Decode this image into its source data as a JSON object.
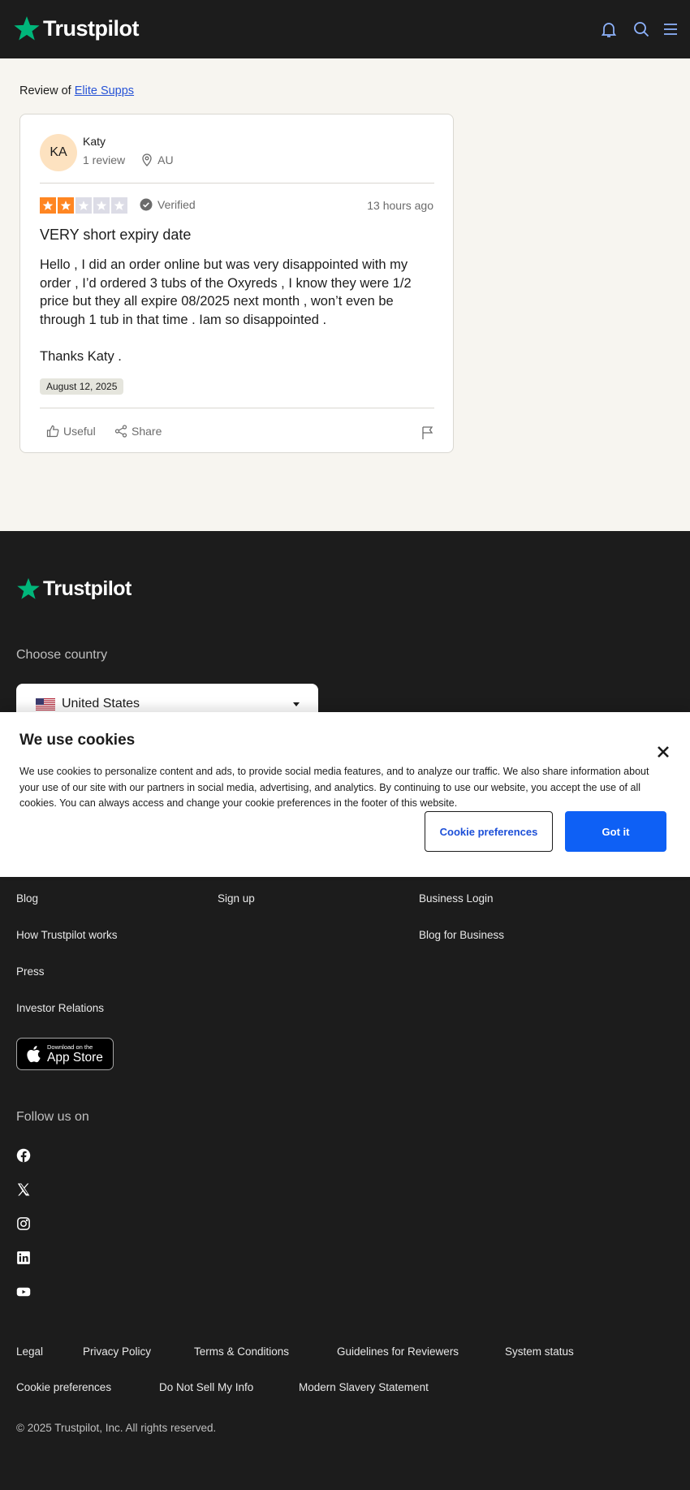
{
  "header": {
    "logo_text": "Trustpilot",
    "icons": [
      "bell-icon",
      "search-icon",
      "menu-icon"
    ],
    "accent_color": "#00b67a",
    "icon_color": "#8fb4ff"
  },
  "breadcrumb": {
    "prefix": "Review of",
    "company": "Elite Supps"
  },
  "review": {
    "initials": "KA",
    "name": "Katy",
    "review_count": "1 review",
    "country": "AU",
    "rating": 2,
    "max_rating": 5,
    "star_color": "#ff8622",
    "verified_label": "Verified",
    "time_ago": "13 hours ago",
    "title": "VERY short expiry date",
    "body": [
      "Hello , I did an order online but was very disappointed with my order , I’d ordered 3 tubs of the Oxyreds , I know they were 1/2 price but they all expire 08/2025 next month , won’t even be through 1 tub in that time . Iam so disappointed .",
      "Thanks Katy ."
    ],
    "date": "August 12, 2025",
    "useful_label": "Useful",
    "share_label": "Share"
  },
  "footer": {
    "logo_text": "Trustpilot",
    "choose_country": "Choose country",
    "country_selected": "United States",
    "links_col1": [
      "Blog",
      "How Trustpilot works",
      "Press",
      "Investor Relations"
    ],
    "links_col2": [
      "Sign up"
    ],
    "links_col3": [
      "Business Login",
      "Blog for Business"
    ],
    "appstore_small": "Download on the",
    "appstore_big": "App Store",
    "follow_us": "Follow us on",
    "social_icons": [
      "facebook-icon",
      "x-icon",
      "instagram-icon",
      "linkedin-icon",
      "youtube-icon"
    ],
    "legal_row1": [
      "Legal",
      "Privacy Policy",
      "Terms & Conditions",
      "Guidelines for Reviewers",
      "System status"
    ],
    "legal_row2": [
      "Cookie preferences",
      "Do Not Sell My Info",
      "Modern Slavery Statement"
    ],
    "copyright": "© 2025 Trustpilot, Inc. All rights reserved."
  },
  "cookie_banner": {
    "title": "We use cookies",
    "text": "We use cookies to personalize content and ads, to provide social media features, and to analyze our traffic. We also share information about your use of our site with our partners in social media, advertising, and analytics. By continuing to use our website, you accept the use of all cookies. You can always access and change your cookie preferences in the footer of this website.",
    "preferences_label": "Cookie preferences",
    "accept_label": "Got it",
    "accept_color": "#0e60f5"
  }
}
